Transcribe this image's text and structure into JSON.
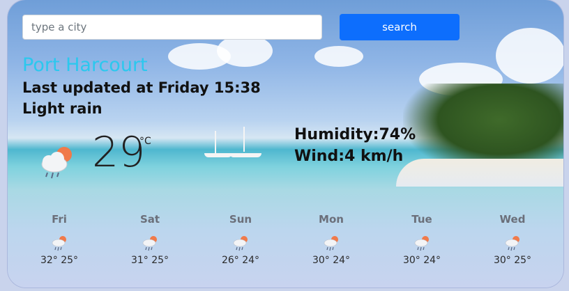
{
  "search": {
    "placeholder": "type a city",
    "button_label": "search"
  },
  "current": {
    "city": "Port Harcourt",
    "updated": "Last updated at Friday 15:38",
    "condition": "Light rain",
    "temperature": "29",
    "unit": "°C",
    "humidity": "Humidity:74%",
    "wind": "Wind:4 km/h",
    "icon": "rain-cloud-sun-icon"
  },
  "forecast": [
    {
      "day": "Fri",
      "temps": "32° 25°",
      "icon": "rain-cloud-sun-icon"
    },
    {
      "day": "Sat",
      "temps": "31° 25°",
      "icon": "rain-cloud-sun-icon"
    },
    {
      "day": "Sun",
      "temps": "26° 24°",
      "icon": "rain-cloud-sun-icon"
    },
    {
      "day": "Mon",
      "temps": "30° 24°",
      "icon": "rain-cloud-sun-icon"
    },
    {
      "day": "Tue",
      "temps": "30° 24°",
      "icon": "rain-cloud-sun-icon"
    },
    {
      "day": "Wed",
      "temps": "30° 25°",
      "icon": "rain-cloud-sun-icon"
    }
  ],
  "colors": {
    "city": "#2bc8ee",
    "button": "#0d6efd",
    "sun": "#f07a4a"
  }
}
